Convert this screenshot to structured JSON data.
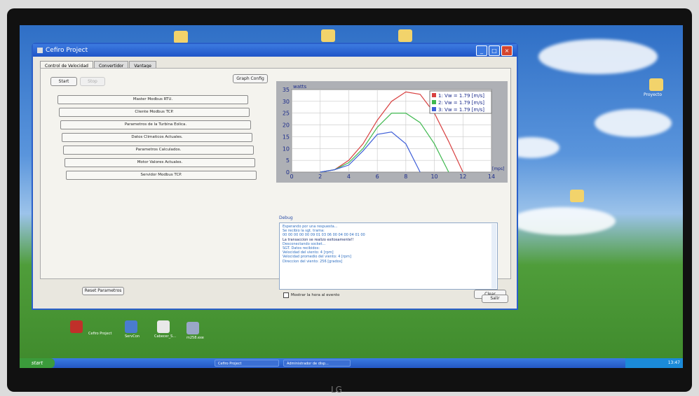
{
  "window": {
    "title": "Cefiro Project"
  },
  "tabs": [
    "Control de Velocidad",
    "Convertidor",
    "Vantage"
  ],
  "buttons": {
    "start": "Start",
    "stop": "Stop",
    "graph_config": "Graph Config",
    "reset": "Reset Parametros",
    "exit": "Salir",
    "clear": "Clear"
  },
  "menu_buttons": [
    "Master Modbus RTU.",
    "Cliente Modbus TCP.",
    "Parametros de la Turbina Eolica.",
    "Datos Climaticos Actuales.",
    "Parametros Calculados.",
    "Motor Valores Actuales.",
    "Servidor Modbus TCP."
  ],
  "debug": {
    "label": "Debug",
    "lines": [
      "Esperando por una respuesta...",
      "Se recibio la sgt. trama:",
      "00 00 00 00 00 09 01 03 06 00 04 00 04 01 00",
      "La transaccion se realizo exitosamente!!",
      "Desconectando socket...",
      "",
      "SGT. Datos recibidos:",
      "Velocidad del viento: 4 [rpm]",
      "Velocidad promedio del viento: 4 [rpm]",
      "Direccion del viento: 256 [grados]"
    ],
    "checkbox_label": "Mostrar la hora al evento"
  },
  "chart_data": {
    "type": "line",
    "ylabel": "watts",
    "xlabel": "[mps]",
    "xlim": [
      0,
      14
    ],
    "ylim": [
      0,
      35
    ],
    "xticks": [
      "0",
      "2",
      "4",
      "6",
      "8",
      "10",
      "12",
      "14"
    ],
    "yticks": [
      "0",
      "5",
      "10",
      "15",
      "20",
      "25",
      "30",
      "35"
    ],
    "grid": true,
    "legend_position": "top-right",
    "series": [
      {
        "name": "1: Vw = 1.79 [m/s]",
        "color": "#d84040",
        "x": [
          2,
          3,
          4,
          5,
          6,
          7,
          8,
          9,
          10,
          11,
          12
        ],
        "values": [
          0,
          1,
          5,
          12,
          22,
          30,
          34,
          33,
          25,
          13,
          0
        ]
      },
      {
        "name": "2: Vw = 1.79 [m/s]",
        "color": "#3fb84f",
        "x": [
          2,
          3,
          4,
          5,
          6,
          7,
          8,
          9,
          10,
          11
        ],
        "values": [
          0,
          1,
          4,
          10,
          19,
          25,
          25,
          21,
          12,
          0
        ]
      },
      {
        "name": "3: Vw = 1.79 [m/s]",
        "color": "#4060d8",
        "x": [
          2,
          3,
          4,
          5,
          6,
          7,
          8,
          9
        ],
        "values": [
          0,
          1,
          3,
          9,
          16,
          17,
          12,
          0
        ]
      }
    ]
  },
  "desktop_icons": [
    "Proyecto"
  ],
  "taskbar": {
    "start": "start",
    "tasks": [
      "Cefiro Project",
      "Administrador de disp..."
    ],
    "clock": "13:47"
  },
  "quick_launch": [
    "Cefiro Project",
    "ServCon",
    "Cabecer_S...",
    "m258.exe"
  ],
  "monitor_brand": "LG"
}
